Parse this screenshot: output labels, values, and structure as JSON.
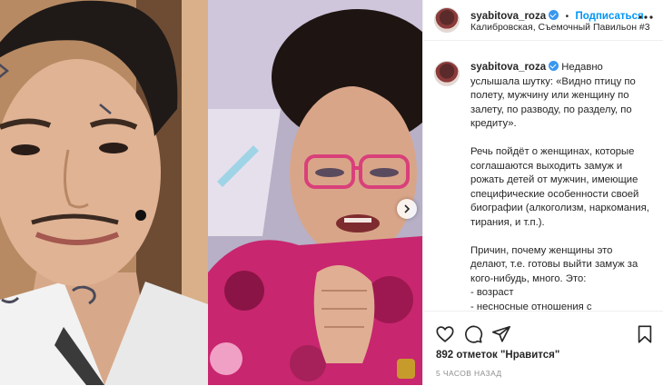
{
  "post": {
    "username": "syabitova_roza",
    "follow_label": "Подписаться",
    "separator": "•",
    "location": "Калибровская, Съемочный Павильон #3",
    "caption": "Недавно услышала шутку: «Видно птицу по полету, мужчину или женщину по залету, по разводу, по разделу, по кредиту».\n\nРечь пойдёт о женщинах, которые соглашаются выходить замуж и рожать детей от мужчин, имеющие специфические особенности своей биографии (алкоголизм, наркомания, тирания, и т.п.).\n\nПричин, почему женщины это делают, т.е. готовы выйти замуж за кого-нибудь, много. Это:\n- возраст\n- несносные отношения с родителями, и хочет убежать из дома куда угодно и к кому угодно\n- отсутствие собственного жилья",
    "likes": "892 отметок \"Нравится\"",
    "time": "5 ЧАСОВ НАЗАД"
  },
  "icons": {
    "verified": "verified-badge-icon",
    "more": "more-options-icon",
    "like": "heart-icon",
    "comment": "comment-icon",
    "share": "share-icon",
    "save": "bookmark-icon",
    "next": "chevron-right-icon"
  },
  "colors": {
    "accent": "#0095f6",
    "verified": "#3897f0",
    "muted": "#8e8e8e",
    "text": "#262626"
  }
}
